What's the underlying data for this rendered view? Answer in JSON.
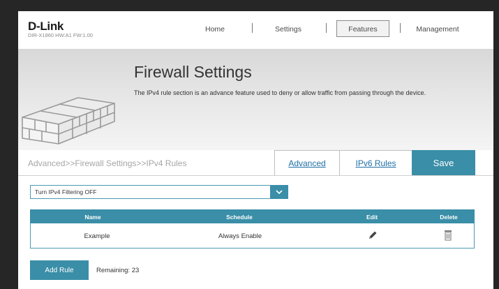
{
  "header": {
    "brand": "D-Link",
    "device_info": "DIR-X1860 HW:A1 FW:1.00",
    "nav": [
      {
        "label": "Home"
      },
      {
        "label": "Settings"
      },
      {
        "label": "Features"
      },
      {
        "label": "Management"
      }
    ],
    "active_nav": "Features"
  },
  "banner": {
    "title": "Firewall Settings",
    "description": "The IPv4 rule section is an advance feature used to deny or allow traffic from passing through the device.",
    "icon": "brick-wall-icon"
  },
  "toolbar": {
    "breadcrumb": "Advanced>>Firewall Settings>>IPv4 Rules",
    "advanced_label": "Advanced",
    "ipv6_label": "IPv6 Rules",
    "save_label": "Save"
  },
  "filter": {
    "selected": "Turn IPv4 Filtering OFF"
  },
  "table": {
    "columns": [
      "Name",
      "Schedule",
      "Edit",
      "Delete"
    ],
    "rows": [
      {
        "name": "Example",
        "schedule": "Always Enable",
        "edit_icon": "pencil-icon",
        "delete_icon": "trash-icon"
      }
    ]
  },
  "footer": {
    "add_label": "Add Rule",
    "remaining": "Remaining: 23"
  },
  "colors": {
    "accent": "#3a8ea7",
    "link": "#1f6fa5",
    "background_outer": "#262626"
  }
}
